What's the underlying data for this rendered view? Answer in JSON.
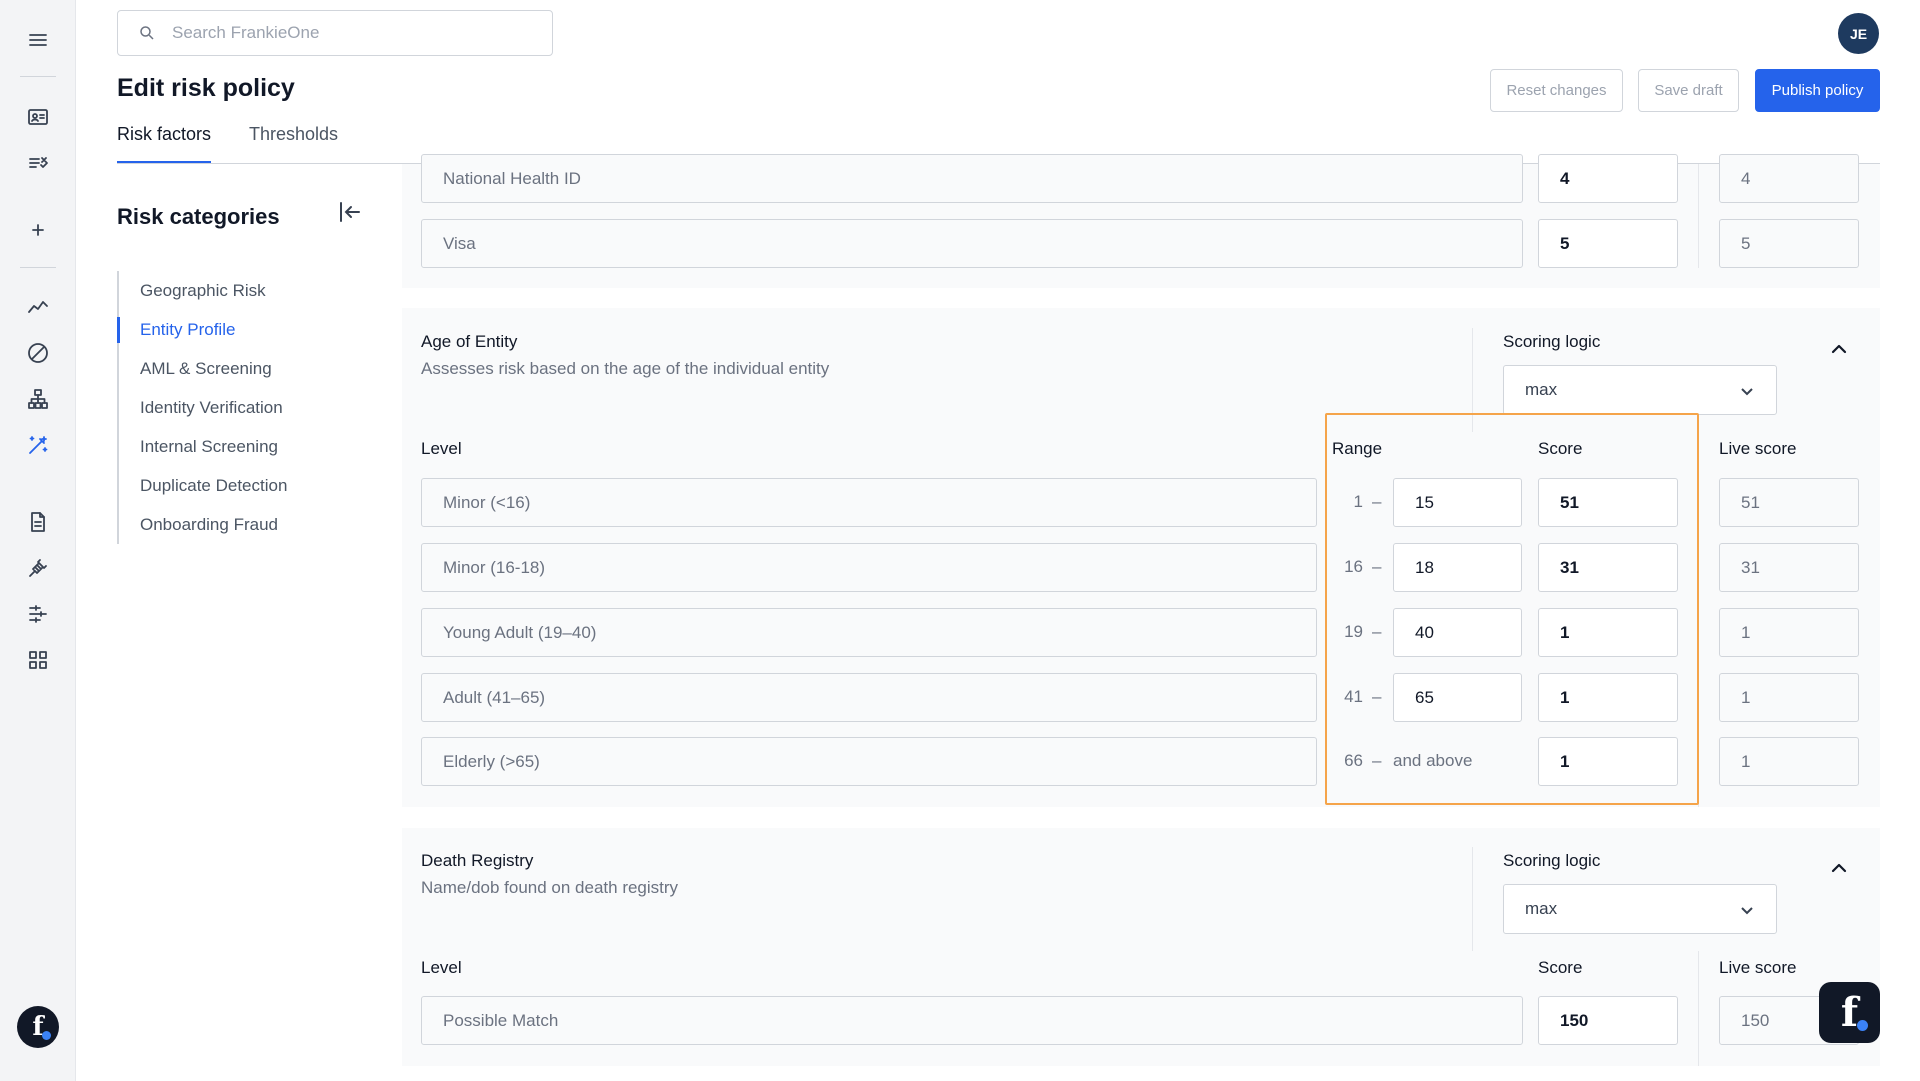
{
  "search": {
    "placeholder": "Search FrankieOne"
  },
  "user": {
    "initials": "JE"
  },
  "page": {
    "title": "Edit risk policy"
  },
  "actions": {
    "reset": "Reset changes",
    "draft": "Save draft",
    "publish": "Publish policy"
  },
  "tabs": [
    {
      "label": "Risk factors",
      "active": true
    },
    {
      "label": "Thresholds",
      "active": false
    }
  ],
  "categories": {
    "title": "Risk categories",
    "items": [
      {
        "label": "Geographic Risk"
      },
      {
        "label": "Entity Profile",
        "active": true
      },
      {
        "label": "AML & Screening"
      },
      {
        "label": "Identity Verification"
      },
      {
        "label": "Internal Screening"
      },
      {
        "label": "Duplicate Detection"
      },
      {
        "label": "Onboarding Fraud"
      }
    ]
  },
  "id_types": {
    "rows": [
      {
        "label": "National Health ID",
        "score": "4",
        "live": "4"
      },
      {
        "label": "Visa",
        "score": "5",
        "live": "5"
      }
    ]
  },
  "age_of_entity": {
    "title": "Age of Entity",
    "description": "Assesses risk based on the age of the individual entity",
    "scoring_logic_label": "Scoring logic",
    "scoring_logic_value": "max",
    "headers": {
      "level": "Level",
      "range": "Range",
      "score": "Score",
      "live": "Live score"
    },
    "rows": [
      {
        "label": "Minor (<16)",
        "from": "1",
        "dash": "–",
        "to": "15",
        "score": "51",
        "live": "51"
      },
      {
        "label": "Minor (16-18)",
        "from": "16",
        "dash": "–",
        "to": "18",
        "score": "31",
        "live": "31"
      },
      {
        "label": "Young Adult (19–40)",
        "from": "19",
        "dash": "–",
        "to": "40",
        "score": "1",
        "live": "1"
      },
      {
        "label": "Adult (41–65)",
        "from": "41",
        "dash": "–",
        "to": "65",
        "score": "1",
        "live": "1"
      },
      {
        "label": "Elderly (>65)",
        "from": "66",
        "dash": "–",
        "to": "and above",
        "score": "1",
        "live": "1"
      }
    ]
  },
  "death_registry": {
    "title": "Death Registry",
    "description": "Name/dob found on death registry",
    "scoring_logic_label": "Scoring logic",
    "scoring_logic_value": "max",
    "headers": {
      "level": "Level",
      "score": "Score",
      "live": "Live score"
    },
    "rows": [
      {
        "label": "Possible Match",
        "score": "150",
        "live": "150"
      }
    ]
  },
  "colors": {
    "accent": "#2563eb",
    "highlight": "#f5a44a",
    "dark": "#111827"
  }
}
